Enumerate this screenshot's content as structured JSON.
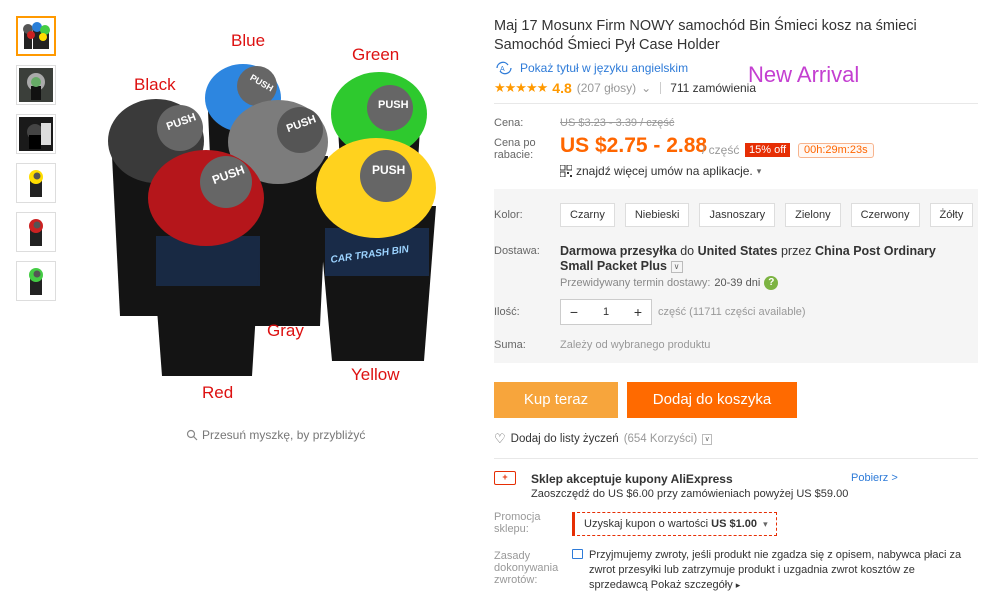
{
  "thumbnails": [
    {
      "name": "thumb-group",
      "active": true
    },
    {
      "name": "thumb-car"
    },
    {
      "name": "thumb-dark"
    },
    {
      "name": "thumb-yellow"
    },
    {
      "name": "thumb-red"
    },
    {
      "name": "thumb-green"
    }
  ],
  "image": {
    "labels": {
      "blue": "Blue",
      "green": "Green",
      "black": "Black",
      "gray": "Gray",
      "red": "Red",
      "yellow": "Yellow"
    },
    "lid_text": "PUSH",
    "bin_text": "CAR TRASH BIN",
    "zoom_hint": "Przesuń myszkę, by przybliżyć"
  },
  "product": {
    "title": "Maj 17 Mosunx Firm NOWY samochód Bin Śmieci kosz na śmieci Samochód Śmieci Pył Case Holder",
    "translate_link": "Pokaż tytuł w języku angielskim",
    "new_arrival": "New Arrival",
    "stars": "★★★★★",
    "rating": "4.8",
    "votes": "(207 głosy)",
    "votes_chevron": "⌄",
    "orders": "711 zamówienia"
  },
  "price": {
    "label": "Cena:",
    "old": "US $3.23 - 3.39 / część",
    "discount_label": "Cena po rabacie:",
    "current": "US $2.75 - 2.88",
    "per_unit": "/ część",
    "off_badge": "15% off",
    "timer": "00h:29m:23s",
    "app_deals": "znajdź więcej umów na aplikacje.",
    "app_deals_chevron": "▾"
  },
  "options": {
    "color_label": "Kolor:",
    "colors": [
      "Czarny",
      "Niebieski",
      "Jasnoszary",
      "Zielony",
      "Czerwony",
      "Żółty"
    ],
    "shipping_label": "Dostawa:",
    "shipping_prefix": "Darmowa przesyłka",
    "shipping_mid": " do ",
    "shipping_country": "United States",
    "shipping_via": " przez ",
    "shipping_method": "China Post Ordinary Small Packet Plus",
    "eta_label": "Przewidywany termin dostawy:",
    "eta_days": "20-39 dni",
    "qty_label": "Ilość:",
    "qty_value": "1",
    "qty_minus": "−",
    "qty_plus": "+",
    "qty_info": "część (11711 części available)",
    "total_label": "Suma:",
    "total_value": "Zależy od wybranego produktu"
  },
  "actions": {
    "buy_now": "Kup teraz",
    "add_to_cart": "Dodaj do koszyka",
    "wishlist": "Dodaj do listy życzeń",
    "wishlist_count": "(654 Korzyści)"
  },
  "coupon": {
    "icon_text": "+",
    "title": "Sklep akceptuje kupony AliExpress",
    "link": "Pobierz >",
    "subtitle": "Zaoszczędź do US $6.00 przy zamówieniach powyżej US $59.00",
    "promo_label": "Promocja sklepu:",
    "promo_text": "Uzyskaj kupon o wartości",
    "promo_amount": "US $1.00",
    "promo_chevron": "▾"
  },
  "returns": {
    "label": "Zasady dokonywania zwrotów:",
    "text": "Przyjmujemy zwroty, jeśli produkt nie zgadza się z opisem, nabywca płaci za zwrot przesyłki lub zatrzymuje produkt i uzgadnia zwrot kosztów ze sprzedawcą",
    "more": "Pokaż szczegóły",
    "more_arrow": "▸"
  },
  "colors": {
    "accent_orange": "#ff6a00",
    "buy_orange": "#f7a53c",
    "link_blue": "#2e7bd8",
    "new_arrival_purple": "#c43fd1",
    "badge_red": "#e62e04"
  }
}
